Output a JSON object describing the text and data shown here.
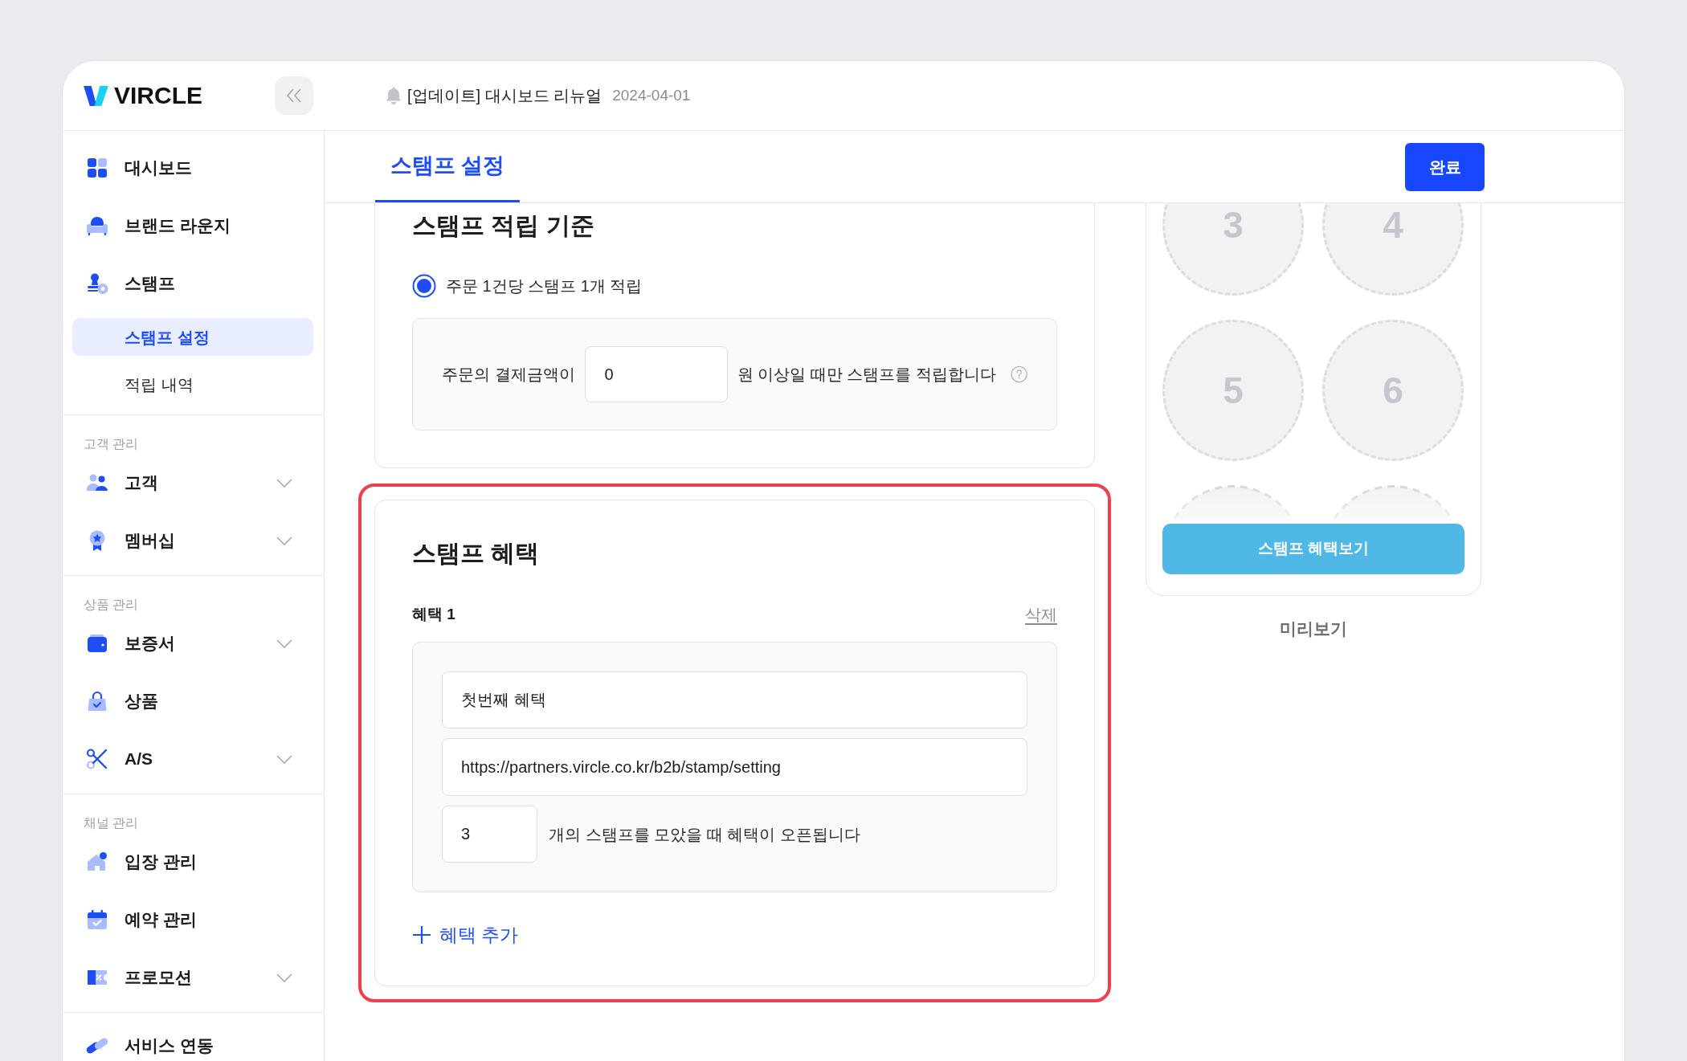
{
  "header": {
    "logo": "VIRCLE",
    "notice": {
      "text": "[업데이트] 대시보드 리뉴얼",
      "date": "2024-04-01"
    }
  },
  "sidebar": {
    "groups": [
      {
        "items": [
          {
            "label": "대시보드",
            "expandable": false,
            "selected": false
          },
          {
            "label": "브랜드 라운지",
            "expandable": false,
            "selected": false
          },
          {
            "label": "스탬프",
            "expandable": false,
            "selected": false,
            "children": [
              {
                "label": "스탬프 설정",
                "selected": true
              },
              {
                "label": "적립 내역",
                "selected": false
              }
            ]
          }
        ]
      },
      {
        "label": "고객 관리",
        "items": [
          {
            "label": "고객",
            "expandable": true,
            "selected": false
          },
          {
            "label": "멤버십",
            "expandable": true,
            "selected": false
          }
        ]
      },
      {
        "label": "상품 관리",
        "items": [
          {
            "label": "보증서",
            "expandable": true,
            "selected": false
          },
          {
            "label": "상품",
            "expandable": false,
            "selected": false
          },
          {
            "label": "A/S",
            "expandable": true,
            "selected": false
          }
        ]
      },
      {
        "label": "채널 관리",
        "items": [
          {
            "label": "입장 관리",
            "expandable": false,
            "selected": false
          },
          {
            "label": "예약 관리",
            "expandable": false,
            "selected": false
          },
          {
            "label": "프로모션",
            "expandable": true,
            "selected": false
          }
        ]
      },
      {
        "items": [
          {
            "label": "서비스 연동",
            "expandable": false,
            "selected": false
          }
        ]
      }
    ]
  },
  "tabs": [
    {
      "label": "스탬프 설정",
      "selected": true
    }
  ],
  "done_button": "완료",
  "earning_card": {
    "title": "스탬프 적립 기준",
    "options": [
      {
        "label": "주문 1건당 스탬프 1개 적립",
        "selected": true
      }
    ],
    "condition": {
      "prefix": "주문의 결제금액이",
      "value": "0",
      "suffix": "원 이상일 때만 스탬프를 적립합니다"
    }
  },
  "benefit_card": {
    "title": "스탬프 혜택",
    "highlighted": true,
    "benefits": [
      {
        "label": "혜택 1",
        "delete": "삭제",
        "name": "첫번째 혜택",
        "url": "https://partners.vircle.co.kr/b2b/stamp/setting",
        "count": "3",
        "count_suffix": "개의 스탬프를 모았을 때 혜택이 오픈됩니다"
      }
    ],
    "add_button": "혜택 추가"
  },
  "preview": {
    "stamps": [
      {
        "label": "3",
        "faded": false
      },
      {
        "label": "4",
        "faded": false
      },
      {
        "label": "5",
        "faded": false
      },
      {
        "label": "6",
        "faded": false
      },
      {
        "faded": true
      },
      {
        "faded": true
      }
    ],
    "button": "스탬프 혜택보기",
    "caption": "미리보기"
  }
}
